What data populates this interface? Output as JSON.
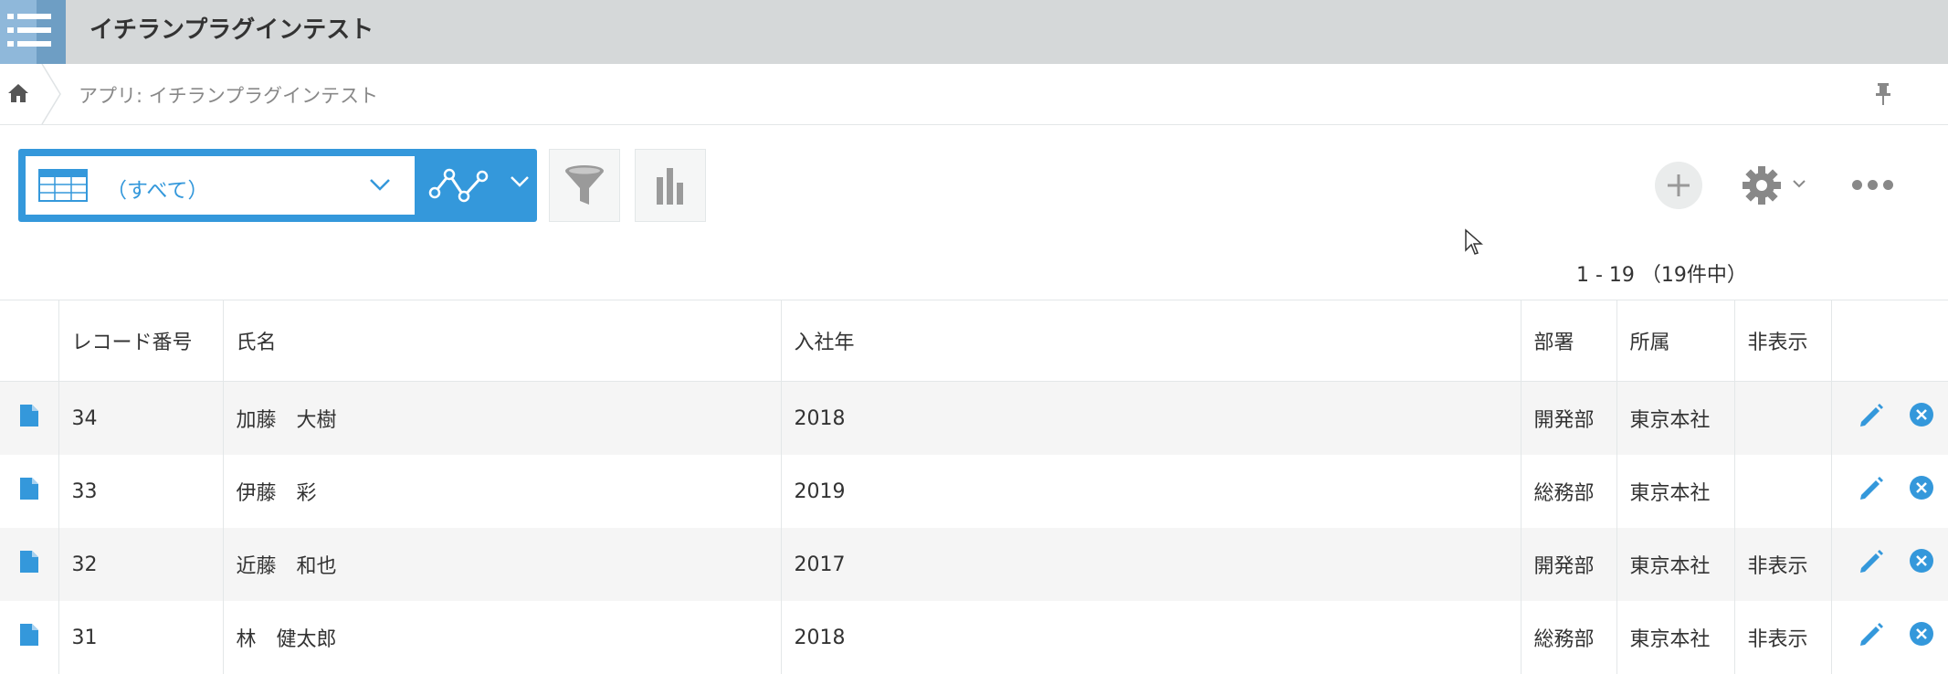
{
  "header": {
    "app_title": "イチランプラグインテスト"
  },
  "breadcrumb": {
    "text": "アプリ: イチランプラグインテスト"
  },
  "toolbar": {
    "view_name": "（すべて）",
    "pagination": "1 - 19 （19件中）"
  },
  "table": {
    "columns": [
      "レコード番号",
      "氏名",
      "入社年",
      "部署",
      "所属",
      "非表示"
    ],
    "rows": [
      {
        "record_no": "34",
        "name": "加藤　大樹",
        "year": "2018",
        "dept": "開発部",
        "affiliation": "東京本社",
        "hidden": ""
      },
      {
        "record_no": "33",
        "name": "伊藤　彩",
        "year": "2019",
        "dept": "総務部",
        "affiliation": "東京本社",
        "hidden": ""
      },
      {
        "record_no": "32",
        "name": "近藤　和也",
        "year": "2017",
        "dept": "開発部",
        "affiliation": "東京本社",
        "hidden": "非表示"
      },
      {
        "record_no": "31",
        "name": "林　健太郎",
        "year": "2018",
        "dept": "総務部",
        "affiliation": "東京本社",
        "hidden": "非表示"
      }
    ]
  },
  "colors": {
    "accent": "#3498db",
    "header_bg": "#d5d8d9",
    "row_alt": "#f5f5f5"
  },
  "icons": {
    "app": "list-icon",
    "home": "home-icon",
    "pin": "pin-icon",
    "view": "table-icon",
    "graph": "line-graph-icon",
    "filter": "filter-icon",
    "chart": "bar-chart-icon",
    "add": "plus-icon",
    "settings": "gear-icon",
    "more": "more-icon",
    "detail": "document-icon",
    "edit": "pencil-icon",
    "delete": "close-circle-icon"
  }
}
